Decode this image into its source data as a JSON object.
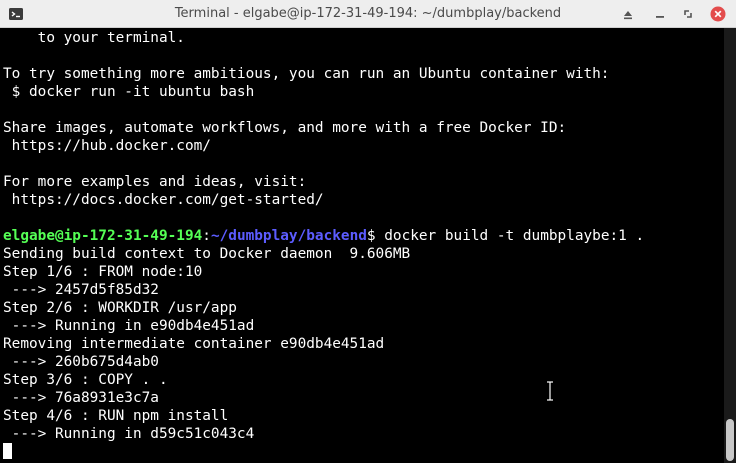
{
  "window": {
    "title": "Terminal - elgabe@ip-172-31-49-194: ~/dumbplay/backend",
    "icons": [
      "terminal-app-icon",
      "shade-icon",
      "minimize-icon",
      "maximize-icon",
      "close-icon"
    ],
    "close_color": "#e34c4c"
  },
  "terminal": {
    "colors": {
      "background": "#000000",
      "text": "#ffffff",
      "user": "#55ff55",
      "path": "#5c5cff"
    },
    "lines": [
      "    to your terminal.",
      "",
      "To try something more ambitious, you can run an Ubuntu container with:",
      " $ docker run -it ubuntu bash",
      "",
      "Share images, automate workflows, and more with a free Docker ID:",
      " https://hub.docker.com/",
      "",
      "For more examples and ideas, visit:",
      " https://docs.docker.com/get-started/",
      ""
    ],
    "prompt": {
      "user_host": "elgabe@ip-172-31-49-194",
      "colon": ":",
      "path": "~/dumbplay/backend",
      "symbol": "$",
      "command": " docker build -t dumbplaybe:1 ."
    },
    "output": [
      "Sending build context to Docker daemon  9.606MB",
      "Step 1/6 : FROM node:10",
      " ---> 2457d5f85d32",
      "Step 2/6 : WORKDIR /usr/app",
      " ---> Running in e90db4e451ad",
      "Removing intermediate container e90db4e451ad",
      " ---> 260b675d4ab0",
      "Step 3/6 : COPY . .",
      " ---> 76a8931e3c7a",
      "Step 4/6 : RUN npm install",
      " ---> Running in d59c51c043c4"
    ]
  }
}
